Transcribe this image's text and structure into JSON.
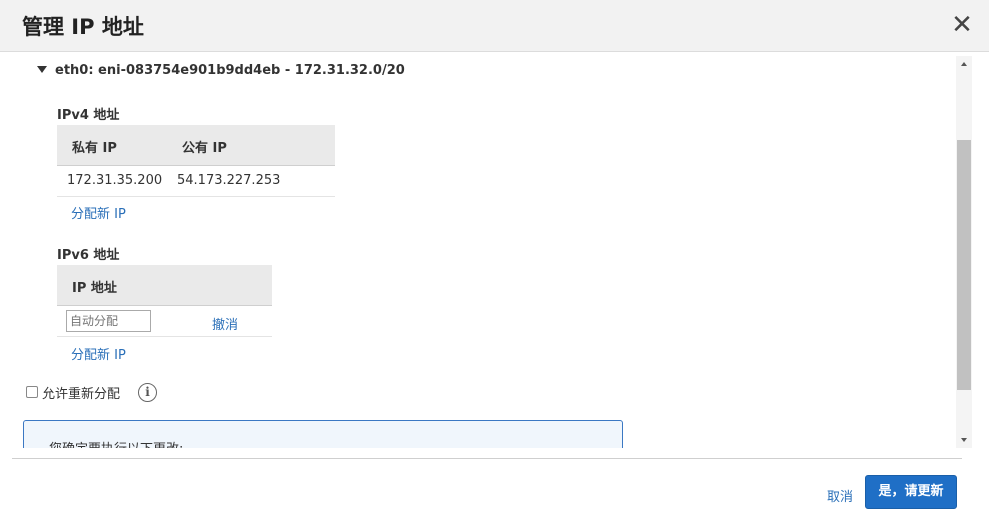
{
  "dialog": {
    "title": "管理 IP 地址",
    "close_glyph": "✕"
  },
  "eni": {
    "header": "eth0: eni-083754e901b9dd4eb - 172.31.32.0/20"
  },
  "ipv4": {
    "label": "IPv4 地址",
    "columns": [
      "私有 IP",
      "公有 IP"
    ],
    "rows": [
      {
        "private_ip": "172.31.35.200",
        "public_ip": "54.173.227.253"
      }
    ],
    "assign_link": "分配新 IP"
  },
  "ipv6": {
    "label": "IPv6 地址",
    "columns": [
      "IP 地址"
    ],
    "input_placeholder": "自动分配",
    "undo_link": "撤消",
    "assign_link": "分配新 IP"
  },
  "reassign": {
    "label": "允许重新分配",
    "checked": false,
    "info_glyph": "i"
  },
  "confirm": {
    "text": "您确定要执行以下更改:"
  },
  "footer": {
    "cancel_label": "取消",
    "confirm_label": "是，请更新"
  }
}
